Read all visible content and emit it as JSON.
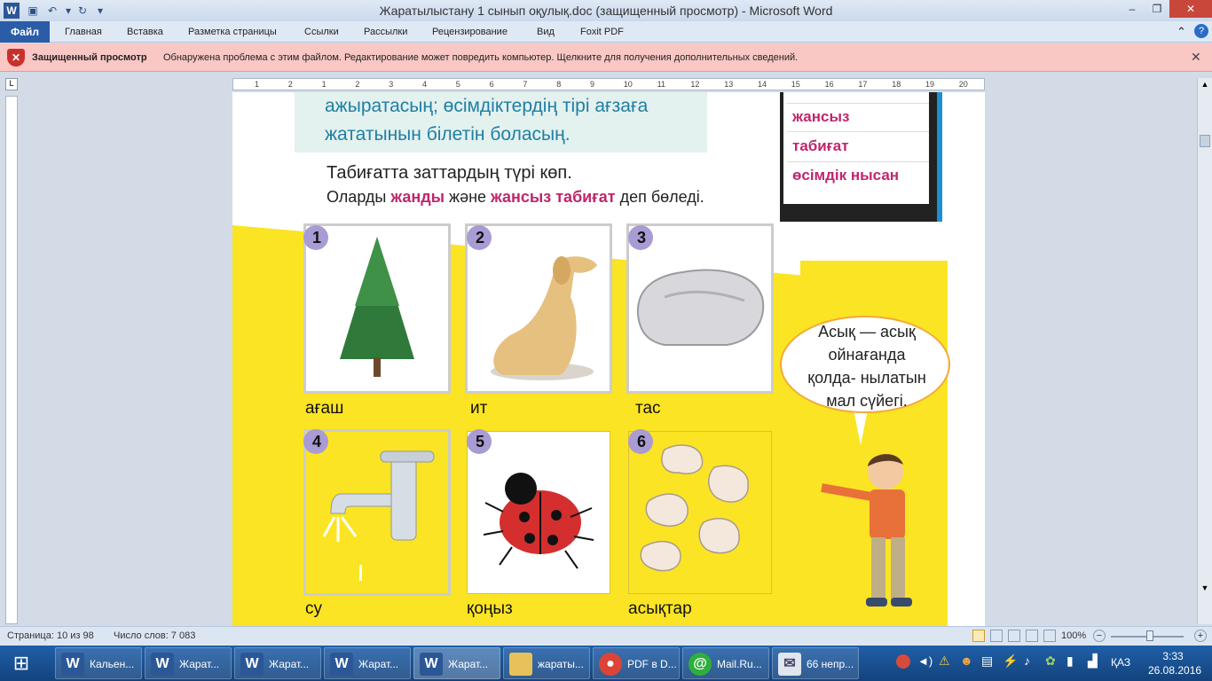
{
  "window": {
    "title": "Жаратылыстану 1 сынып оқулық.doc (защищенный просмотр)  -  Microsoft Word",
    "controls": {
      "minimize": "–",
      "maximize": "❐",
      "close": "✕"
    }
  },
  "ribbon": {
    "file_tab": "Файл",
    "tabs": [
      "Главная",
      "Вставка",
      "Разметка страницы",
      "Ссылки",
      "Рассылки",
      "Рецензирование",
      "Вид",
      "Foxit PDF"
    ]
  },
  "protected_view": {
    "title": "Защищенный просмотр",
    "message": "Обнаружена проблема с этим файлом. Редактирование может повредить компьютер. Щелкните для получения дополнительных сведений."
  },
  "ruler": {
    "numbers": [
      "1",
      "2",
      "1",
      "2",
      "3",
      "4",
      "5",
      "6",
      "7",
      "8",
      "9",
      "10",
      "11",
      "12",
      "13",
      "14",
      "15",
      "16",
      "17",
      "18",
      "19",
      "20"
    ]
  },
  "document": {
    "goal_line1": "ажыратасың; өсімдіктердің тірі ағзаға",
    "goal_line2": "жататынын білетін боласың.",
    "sentence1": "Табиғатта заттардың түрі көп.",
    "sentence2_a": "Оларды ",
    "sentence2_b": "жанды",
    "sentence2_c": " және ",
    "sentence2_d": "жансыз табиғат",
    "sentence2_e": " деп бөледі.",
    "vocab": [
      "жансыз",
      "табиғат",
      "өсімдік нысан"
    ],
    "cards": [
      {
        "num": "1",
        "caption": "ағаш",
        "icon": "tree-icon"
      },
      {
        "num": "2",
        "caption": "ит",
        "icon": "dog-icon"
      },
      {
        "num": "3",
        "caption": "тас",
        "icon": "stone-icon"
      },
      {
        "num": "4",
        "caption": "су",
        "icon": "faucet-icon"
      },
      {
        "num": "5",
        "caption": "қоңыз",
        "icon": "ladybug-icon"
      },
      {
        "num": "6",
        "caption": "асықтар",
        "icon": "knucklebones-icon"
      }
    ],
    "bubble": [
      "Асық — асық",
      "ойнағанда",
      "қолда- нылатын",
      "мал сүйегі."
    ]
  },
  "status": {
    "page": "Страница: 10 из 98",
    "words": "Число слов: 7 083",
    "zoom": "100%"
  },
  "taskbar": {
    "items": [
      {
        "label": "Кальен...",
        "icon": "word-icon"
      },
      {
        "label": "Жарат...",
        "icon": "word-icon"
      },
      {
        "label": "Жарат...",
        "icon": "word-icon"
      },
      {
        "label": "Жарат...",
        "icon": "word-icon"
      },
      {
        "label": "Жарат...",
        "icon": "word-icon"
      },
      {
        "label": "жараты...",
        "icon": "folder-icon"
      },
      {
        "label": "PDF в D...",
        "icon": "chrome-icon"
      },
      {
        "label": "Mail.Ru...",
        "icon": "mailru-icon"
      },
      {
        "label": "66 непр...",
        "icon": "mail-icon"
      }
    ],
    "lang": "ҚАЗ",
    "time": "3:33",
    "date": "26.08.2016"
  }
}
